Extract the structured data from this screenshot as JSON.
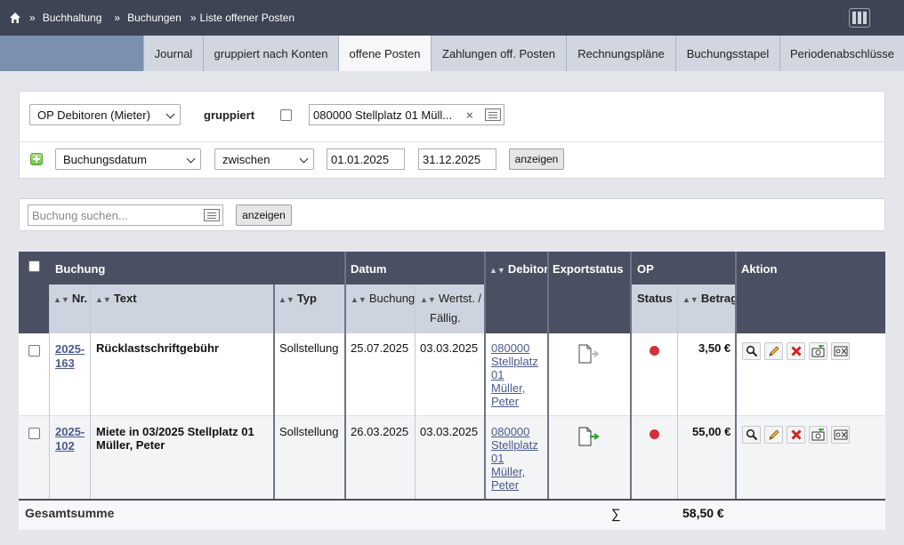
{
  "breadcrumb": {
    "items": [
      "Buchhaltung",
      "Buchungen",
      "Liste offener Posten"
    ],
    "separators": [
      "»",
      "»",
      "»"
    ]
  },
  "tabs": [
    {
      "label": "Journal",
      "active": false
    },
    {
      "label": "gruppiert nach Konten",
      "active": false
    },
    {
      "label": "offene Posten",
      "active": true
    },
    {
      "label": "Zahlungen off. Posten",
      "active": false
    },
    {
      "label": "Rechnungspläne",
      "active": false
    },
    {
      "label": "Buchungsstapel",
      "active": false
    },
    {
      "label": "Periodenabschlüsse",
      "active": false
    }
  ],
  "filter": {
    "op_type": "OP Debitoren (Mieter)",
    "grouped_label": "gruppiert",
    "grouped_checked": false,
    "account": "080000 Stellplatz 01 Müll...",
    "date_field": "Buchungsdatum",
    "date_op": "zwischen",
    "date_from": "01.01.2025",
    "date_to": "31.12.2025",
    "show_label": "anzeigen"
  },
  "search": {
    "placeholder": "Buchung suchen...",
    "show_label": "anzeigen"
  },
  "table": {
    "group_headers": {
      "buchung": "Buchung",
      "datum": "Datum",
      "debitor": "Debitor",
      "exportstatus": "Exportstatus",
      "op": "OP",
      "aktion": "Aktion"
    },
    "sub_headers": {
      "nr": "Nr.",
      "text": "Text",
      "typ": "Typ",
      "buchung": "Buchung",
      "wertst": "Wertst. /",
      "faellig": "Fällig.",
      "status": "Status",
      "betrag": "Betrag"
    },
    "rows": [
      {
        "nr_line1": "2025-",
        "nr_line2": "163",
        "text": "Rücklastschriftgebühr",
        "typ": "Sollstellung",
        "buchung": "25.07.2025",
        "wertst": "03.03.2025",
        "debitor": [
          "080000",
          "Stellplatz",
          "01",
          "Müller,",
          "Peter"
        ],
        "export_status": "pending",
        "status_color": "#d3303a",
        "betrag": "3,50 €"
      },
      {
        "nr_line1": "2025-",
        "nr_line2": "102",
        "text": "Miete in 03/2025 Stellplatz 01 Müller, Peter",
        "typ": "Sollstellung",
        "buchung": "26.03.2025",
        "wertst": "03.03.2025",
        "debitor": [
          "080000",
          "Stellplatz",
          "01",
          "Müller,",
          "Peter"
        ],
        "export_status": "exported",
        "status_color": "#d3303a",
        "betrag": "55,00 €"
      }
    ],
    "total": {
      "label": "Gesamtsumme",
      "sigma": "∑",
      "value": "58,50 €"
    },
    "actions": [
      "search-icon",
      "edit-pencil-icon",
      "delete-x-icon",
      "rebook-icon",
      "split-icon"
    ]
  },
  "colors": {
    "topbar": "#3d4453",
    "tabbar": "#8f9fbd",
    "table_header": "#4a5062",
    "status_open": "#d3303a",
    "link": "#4b5a8a"
  }
}
